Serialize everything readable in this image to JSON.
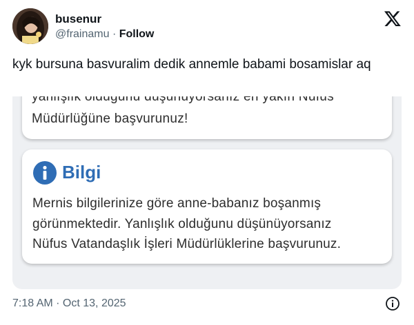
{
  "header": {
    "display_name": "busenur",
    "handle": "@frainamu",
    "separator": " · ",
    "follow_label": "Follow"
  },
  "tweet": {
    "text": "kyk bursuna basvuralim dedik annemle babami bosamislar aq"
  },
  "media": {
    "cut_line": "yanlışlık olduğunu düşünüyorsanız en yakın Nüfus",
    "prev_message_line": "Müdürlüğüne başvurunuz!",
    "info_title": "Bilgi",
    "info_lines": [
      "Mernis bilgilerinize göre anne-babanız boşanmış",
      "görünmektedir. Yanlışlık olduğunu düşünüyorsanız",
      "Nüfus Vatandaşlık İşleri Müdürlüklerine başvurunuz."
    ]
  },
  "footer": {
    "timestamp": "7:18 AM · Oct 13, 2025"
  },
  "colors": {
    "accent": "#2f6db5",
    "text": "#0f1419",
    "muted": "#536471"
  },
  "icons": [
    "x-logo-icon",
    "info-circle-icon",
    "info-outline-icon"
  ]
}
